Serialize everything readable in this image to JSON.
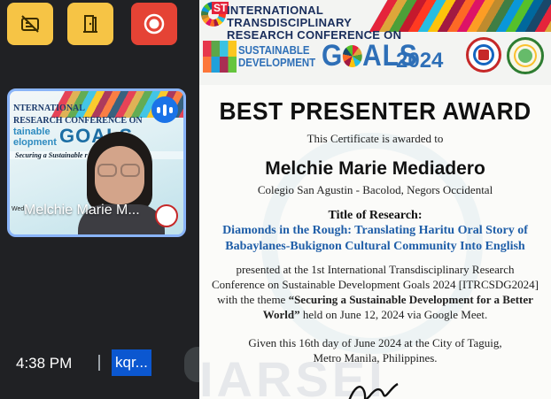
{
  "meeting": {
    "controls": [
      {
        "name": "caption-off-icon",
        "color": "#f6c445"
      },
      {
        "name": "door-exit-icon",
        "color": "#f6c445"
      },
      {
        "name": "record-icon",
        "color": "#e54335"
      }
    ],
    "participant_tile": {
      "name": "Melchie Marie M...",
      "banner_lines": [
        "NTERNATIONAL",
        "RESEARCH CONFERENCE ON",
        "tainable",
        "elopment"
      ],
      "banner_goals": "GOALS",
      "banner_theme": "Securing a Sustainable             r World",
      "banner_date": "Wed",
      "audio_icon": "audio-level-icon"
    },
    "clock": "4:38 PM",
    "meeting_code": "kqr..."
  },
  "certificate": {
    "header": {
      "st": "ST",
      "line1": "INTERNATIONAL",
      "line2": "TRANSDISCIPLINARY",
      "line3": "RESEARCH CONFERENCE ON",
      "sustainable": "SUSTAINABLE",
      "development": "DEVELOPMENT",
      "goals_g": "G",
      "goals_rest": "ALS",
      "year": "2024"
    },
    "award_title": "BEST PRESENTER AWARD",
    "awarded_to": "This Certificate is awarded to",
    "recipient": "Melchie Marie Mediadero",
    "school": "Colegio San Agustin - Bacolod, Negors Occidental",
    "title_label": "Title of Research:",
    "research_line1": "Diamonds in the Rough: Translating Haritu Oral Story of",
    "research_line2": "Babaylanes-Bukignon Cultural Community Into English",
    "presented_line1": "presented at the 1st International Transdisciplinary Research",
    "presented_line2": "Conference on Sustainable Development Goals 2024 [ITRCSDG2024]",
    "presented_line3_pre": "with the theme ",
    "presented_line3_bold": "“Securing a Sustainable Development for a Better",
    "presented_line4_bold": "World”",
    "presented_line4_post": " held on June 12, 2024 via Google Meet.",
    "given_line1": "Given this 16th day of June 2024 at the City of Taguig,",
    "given_line2": "Metro Manila, Philippines.",
    "watermark": "IARSEI"
  }
}
